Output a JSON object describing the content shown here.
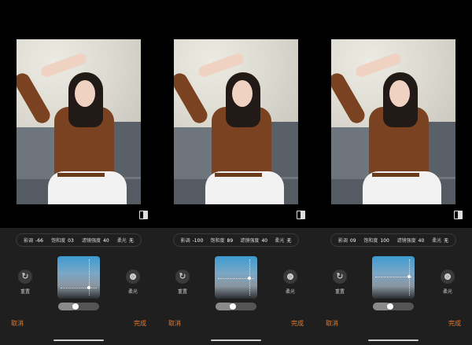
{
  "accent_color": "#e87a2c",
  "panels": [
    {
      "params": [
        {
          "label": "影调",
          "value": "-66"
        },
        {
          "label": "饱和度",
          "value": "03"
        },
        {
          "label": "滤镜强度",
          "value": "40"
        },
        {
          "label": "柔光",
          "value": "无"
        }
      ],
      "reset_label": "重置",
      "soft_label": "柔光",
      "cancel_label": "取消",
      "done_label": "完成",
      "slider_level": 0.4
    },
    {
      "params": [
        {
          "label": "影调",
          "value": "-100"
        },
        {
          "label": "饱和度",
          "value": "89"
        },
        {
          "label": "滤镜强度",
          "value": "40"
        },
        {
          "label": "柔光",
          "value": "无"
        }
      ],
      "reset_label": "重置",
      "soft_label": "柔光",
      "cancel_label": "取消",
      "done_label": "完成",
      "slider_level": 0.4
    },
    {
      "params": [
        {
          "label": "影调",
          "value": "09"
        },
        {
          "label": "饱和度",
          "value": "100"
        },
        {
          "label": "滤镜强度",
          "value": "40"
        },
        {
          "label": "柔光",
          "value": "无"
        }
      ],
      "reset_label": "重置",
      "soft_label": "柔光",
      "cancel_label": "取消",
      "done_label": "完成",
      "slider_level": 0.4
    }
  ],
  "icons": {
    "reset": "reset-icon",
    "soft": "soft-light-icon",
    "compare": "compare-icon"
  }
}
